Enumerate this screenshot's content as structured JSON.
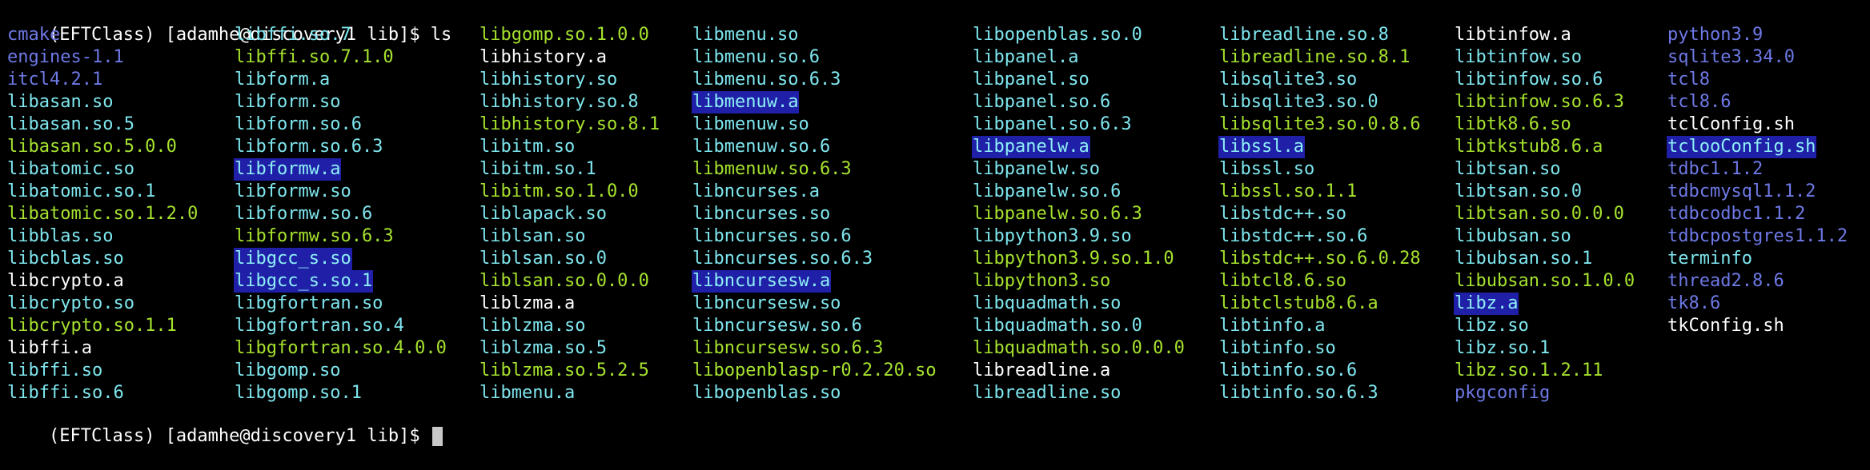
{
  "prompt1": "(EFTClass) [adamhe@discovery1 lib]$ ls",
  "prompt2": "(EFTClass) [adamhe@discovery1 lib]$ ",
  "colors": {
    "dir": "#6e79e6",
    "exec": "#a6e22e",
    "link": "#7ee6ee",
    "file": "#ffffff",
    "highlight_bg": "#1f1fa8"
  },
  "columns": [
    [
      {
        "t": "cmake",
        "c": "dir"
      },
      {
        "t": "engines-1.1",
        "c": "dir"
      },
      {
        "t": "itcl4.2.1",
        "c": "dir"
      },
      {
        "t": "libasan.so",
        "c": "link"
      },
      {
        "t": "libasan.so.5",
        "c": "link"
      },
      {
        "t": "libasan.so.5.0.0",
        "c": "exe"
      },
      {
        "t": "libatomic.so",
        "c": "link"
      },
      {
        "t": "libatomic.so.1",
        "c": "link"
      },
      {
        "t": "libatomic.so.1.2.0",
        "c": "exe"
      },
      {
        "t": "libblas.so",
        "c": "link"
      },
      {
        "t": "libcblas.so",
        "c": "link"
      },
      {
        "t": "libcrypto.a",
        "c": "file"
      },
      {
        "t": "libcrypto.so",
        "c": "link"
      },
      {
        "t": "libcrypto.so.1.1",
        "c": "exe"
      },
      {
        "t": "libffi.a",
        "c": "file"
      },
      {
        "t": "libffi.so",
        "c": "link"
      },
      {
        "t": "libffi.so.6",
        "c": "link"
      }
    ],
    [
      {
        "t": "libffi.so.7",
        "c": "link"
      },
      {
        "t": "libffi.so.7.1.0",
        "c": "exe"
      },
      {
        "t": "libform.a",
        "c": "link"
      },
      {
        "t": "libform.so",
        "c": "link"
      },
      {
        "t": "libform.so.6",
        "c": "link"
      },
      {
        "t": "libform.so.6.3",
        "c": "link"
      },
      {
        "t": "libformw.a",
        "c": "hl"
      },
      {
        "t": "libformw.so",
        "c": "link"
      },
      {
        "t": "libformw.so.6",
        "c": "link"
      },
      {
        "t": "libformw.so.6.3",
        "c": "exe"
      },
      {
        "t": "libgcc_s.so",
        "c": "hl"
      },
      {
        "t": "libgcc_s.so.1",
        "c": "hl"
      },
      {
        "t": "libgfortran.so",
        "c": "link"
      },
      {
        "t": "libgfortran.so.4",
        "c": "link"
      },
      {
        "t": "libgfortran.so.4.0.0",
        "c": "exe"
      },
      {
        "t": "libgomp.so",
        "c": "link"
      },
      {
        "t": "libgomp.so.1",
        "c": "link"
      }
    ],
    [
      {
        "t": "libgomp.so.1.0.0",
        "c": "exe"
      },
      {
        "t": "libhistory.a",
        "c": "file"
      },
      {
        "t": "libhistory.so",
        "c": "link"
      },
      {
        "t": "libhistory.so.8",
        "c": "link"
      },
      {
        "t": "libhistory.so.8.1",
        "c": "exe"
      },
      {
        "t": "libitm.so",
        "c": "link"
      },
      {
        "t": "libitm.so.1",
        "c": "link"
      },
      {
        "t": "libitm.so.1.0.0",
        "c": "exe"
      },
      {
        "t": "liblapack.so",
        "c": "link"
      },
      {
        "t": "liblsan.so",
        "c": "link"
      },
      {
        "t": "liblsan.so.0",
        "c": "link"
      },
      {
        "t": "liblsan.so.0.0.0",
        "c": "exe"
      },
      {
        "t": "liblzma.a",
        "c": "file"
      },
      {
        "t": "liblzma.so",
        "c": "link"
      },
      {
        "t": "liblzma.so.5",
        "c": "link"
      },
      {
        "t": "liblzma.so.5.2.5",
        "c": "exe"
      },
      {
        "t": "libmenu.a",
        "c": "link"
      }
    ],
    [
      {
        "t": "libmenu.so",
        "c": "link"
      },
      {
        "t": "libmenu.so.6",
        "c": "link"
      },
      {
        "t": "libmenu.so.6.3",
        "c": "link"
      },
      {
        "t": "libmenuw.a",
        "c": "hl"
      },
      {
        "t": "libmenuw.so",
        "c": "link"
      },
      {
        "t": "libmenuw.so.6",
        "c": "link"
      },
      {
        "t": "libmenuw.so.6.3",
        "c": "exe"
      },
      {
        "t": "libncurses.a",
        "c": "link"
      },
      {
        "t": "libncurses.so",
        "c": "link"
      },
      {
        "t": "libncurses.so.6",
        "c": "link"
      },
      {
        "t": "libncurses.so.6.3",
        "c": "link"
      },
      {
        "t": "libncursesw.a",
        "c": "hl"
      },
      {
        "t": "libncursesw.so",
        "c": "link"
      },
      {
        "t": "libncursesw.so.6",
        "c": "link"
      },
      {
        "t": "libncursesw.so.6.3",
        "c": "exe"
      },
      {
        "t": "libopenblasp-r0.2.20.so",
        "c": "exe"
      },
      {
        "t": "libopenblas.so",
        "c": "link"
      }
    ],
    [
      {
        "t": "libopenblas.so.0",
        "c": "link"
      },
      {
        "t": "libpanel.a",
        "c": "link"
      },
      {
        "t": "libpanel.so",
        "c": "link"
      },
      {
        "t": "libpanel.so.6",
        "c": "link"
      },
      {
        "t": "libpanel.so.6.3",
        "c": "link"
      },
      {
        "t": "libpanelw.a",
        "c": "hl"
      },
      {
        "t": "libpanelw.so",
        "c": "link"
      },
      {
        "t": "libpanelw.so.6",
        "c": "link"
      },
      {
        "t": "libpanelw.so.6.3",
        "c": "exe"
      },
      {
        "t": "libpython3.9.so",
        "c": "link"
      },
      {
        "t": "libpython3.9.so.1.0",
        "c": "exe"
      },
      {
        "t": "libpython3.so",
        "c": "exe"
      },
      {
        "t": "libquadmath.so",
        "c": "link"
      },
      {
        "t": "libquadmath.so.0",
        "c": "link"
      },
      {
        "t": "libquadmath.so.0.0.0",
        "c": "exe"
      },
      {
        "t": "libreadline.a",
        "c": "file"
      },
      {
        "t": "libreadline.so",
        "c": "link"
      }
    ],
    [
      {
        "t": "libreadline.so.8",
        "c": "link"
      },
      {
        "t": "libreadline.so.8.1",
        "c": "exe"
      },
      {
        "t": "libsqlite3.so",
        "c": "link"
      },
      {
        "t": "libsqlite3.so.0",
        "c": "link"
      },
      {
        "t": "libsqlite3.so.0.8.6",
        "c": "exe"
      },
      {
        "t": "libssl.a",
        "c": "hl"
      },
      {
        "t": "libssl.so",
        "c": "link"
      },
      {
        "t": "libssl.so.1.1",
        "c": "exe"
      },
      {
        "t": "libstdc++.so",
        "c": "link"
      },
      {
        "t": "libstdc++.so.6",
        "c": "link"
      },
      {
        "t": "libstdc++.so.6.0.28",
        "c": "exe"
      },
      {
        "t": "libtcl8.6.so",
        "c": "exe"
      },
      {
        "t": "libtclstub8.6.a",
        "c": "exe"
      },
      {
        "t": "libtinfo.a",
        "c": "link"
      },
      {
        "t": "libtinfo.so",
        "c": "link"
      },
      {
        "t": "libtinfo.so.6",
        "c": "link"
      },
      {
        "t": "libtinfo.so.6.3",
        "c": "link"
      }
    ],
    [
      {
        "t": "libtinfow.a",
        "c": "file"
      },
      {
        "t": "libtinfow.so",
        "c": "link"
      },
      {
        "t": "libtinfow.so.6",
        "c": "link"
      },
      {
        "t": "libtinfow.so.6.3",
        "c": "exe"
      },
      {
        "t": "libtk8.6.so",
        "c": "exe"
      },
      {
        "t": "libtkstub8.6.a",
        "c": "exe"
      },
      {
        "t": "libtsan.so",
        "c": "link"
      },
      {
        "t": "libtsan.so.0",
        "c": "link"
      },
      {
        "t": "libtsan.so.0.0.0",
        "c": "exe"
      },
      {
        "t": "libubsan.so",
        "c": "link"
      },
      {
        "t": "libubsan.so.1",
        "c": "link"
      },
      {
        "t": "libubsan.so.1.0.0",
        "c": "exe"
      },
      {
        "t": "libz.a",
        "c": "hl"
      },
      {
        "t": "libz.so",
        "c": "link"
      },
      {
        "t": "libz.so.1",
        "c": "link"
      },
      {
        "t": "libz.so.1.2.11",
        "c": "exe"
      },
      {
        "t": "pkgconfig",
        "c": "dir"
      }
    ],
    [
      {
        "t": "python3.9",
        "c": "dir"
      },
      {
        "t": "sqlite3.34.0",
        "c": "dir"
      },
      {
        "t": "tcl8",
        "c": "dir"
      },
      {
        "t": "tcl8.6",
        "c": "dir"
      },
      {
        "t": "tclConfig.sh",
        "c": "file"
      },
      {
        "t": "tclooConfig.sh",
        "c": "hl"
      },
      {
        "t": "tdbc1.1.2",
        "c": "dir"
      },
      {
        "t": "tdbcmysql1.1.2",
        "c": "dir"
      },
      {
        "t": "tdbcodbc1.1.2",
        "c": "dir"
      },
      {
        "t": "tdbcpostgres1.1.2",
        "c": "dir"
      },
      {
        "t": "terminfo",
        "c": "link"
      },
      {
        "t": "thread2.8.6",
        "c": "dir"
      },
      {
        "t": "tk8.6",
        "c": "dir"
      },
      {
        "t": "tkConfig.sh",
        "c": "file"
      }
    ]
  ]
}
